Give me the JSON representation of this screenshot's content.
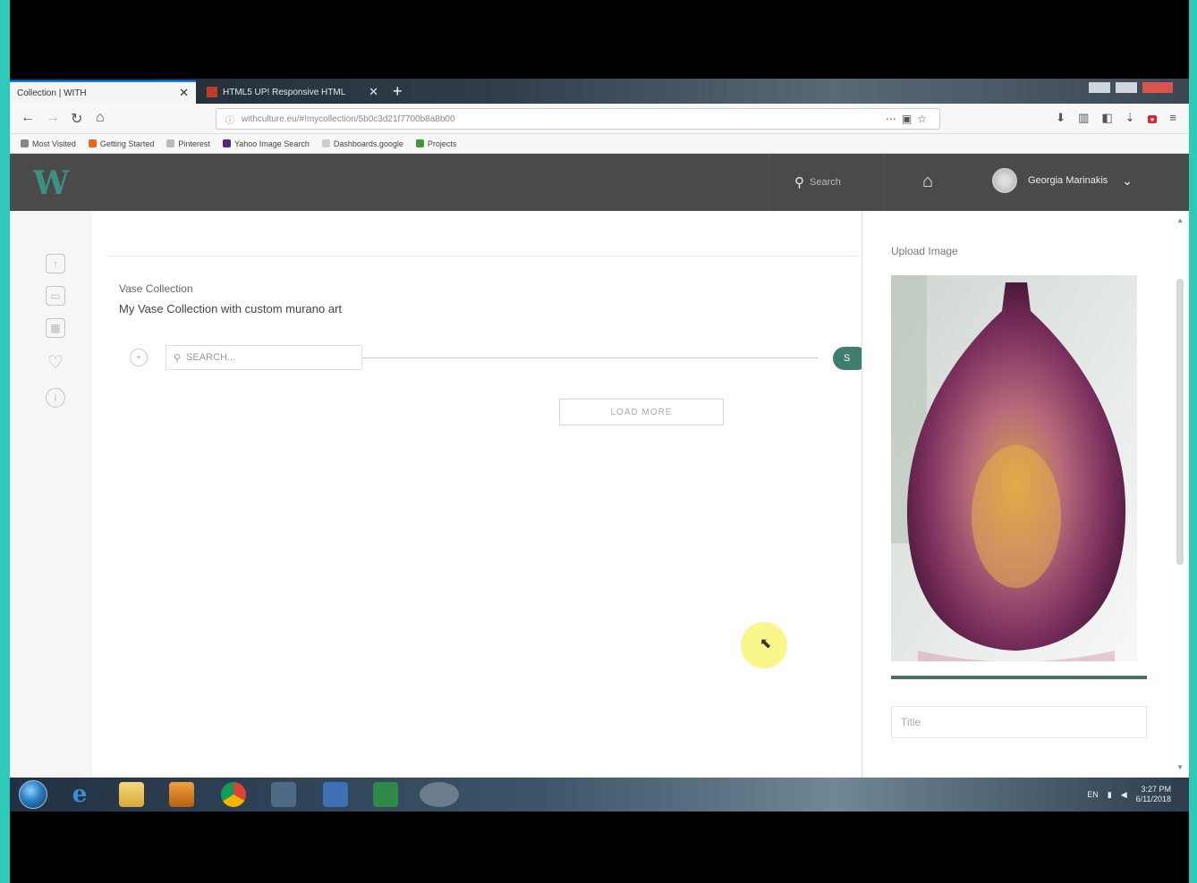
{
  "browser": {
    "tabs": [
      {
        "title": "Collection | WITH",
        "active": true
      },
      {
        "title": "HTML5 UP! Responsive HTML",
        "active": false
      }
    ],
    "url": "withculture.eu/#!mycollection/5b0c3d21f7700b8a8b00",
    "bookmarks": [
      "Most Visited",
      "Getting Started",
      "Pinterest",
      "Yahoo Image Search",
      "Dashboards.google",
      "Projects"
    ]
  },
  "app": {
    "search_placeholder": "Search",
    "user_name": "Georgia Marinakis"
  },
  "collection": {
    "label": "Vase Collection",
    "title": "My Vase Collection with custom murano art",
    "search_placeholder": "SEARCH...",
    "load_more": "LOAD MORE"
  },
  "upload": {
    "label": "Upload Image",
    "progress": 1.0,
    "title_placeholder": "Title"
  },
  "taskbar": {
    "lang": "EN",
    "time": "3:27 PM",
    "date": "6/11/2018"
  },
  "colors": {
    "accent": "#3f7d70",
    "header": "#4a4a4a",
    "frame": "#2ec9b8"
  }
}
